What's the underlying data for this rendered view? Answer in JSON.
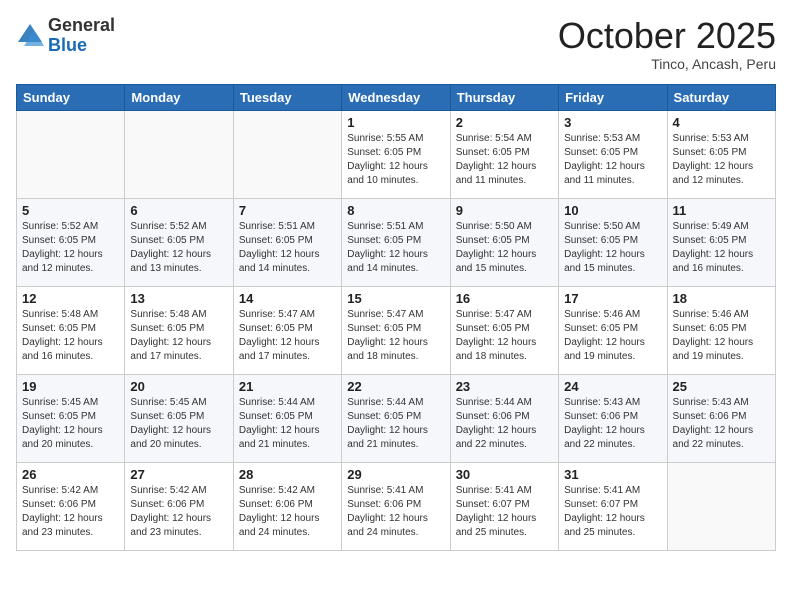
{
  "header": {
    "logo_general": "General",
    "logo_blue": "Blue",
    "month_title": "October 2025",
    "location": "Tinco, Ancash, Peru"
  },
  "weekdays": [
    "Sunday",
    "Monday",
    "Tuesday",
    "Wednesday",
    "Thursday",
    "Friday",
    "Saturday"
  ],
  "weeks": [
    [
      {
        "day": "",
        "info": ""
      },
      {
        "day": "",
        "info": ""
      },
      {
        "day": "",
        "info": ""
      },
      {
        "day": "1",
        "info": "Sunrise: 5:55 AM\nSunset: 6:05 PM\nDaylight: 12 hours\nand 10 minutes."
      },
      {
        "day": "2",
        "info": "Sunrise: 5:54 AM\nSunset: 6:05 PM\nDaylight: 12 hours\nand 11 minutes."
      },
      {
        "day": "3",
        "info": "Sunrise: 5:53 AM\nSunset: 6:05 PM\nDaylight: 12 hours\nand 11 minutes."
      },
      {
        "day": "4",
        "info": "Sunrise: 5:53 AM\nSunset: 6:05 PM\nDaylight: 12 hours\nand 12 minutes."
      }
    ],
    [
      {
        "day": "5",
        "info": "Sunrise: 5:52 AM\nSunset: 6:05 PM\nDaylight: 12 hours\nand 12 minutes."
      },
      {
        "day": "6",
        "info": "Sunrise: 5:52 AM\nSunset: 6:05 PM\nDaylight: 12 hours\nand 13 minutes."
      },
      {
        "day": "7",
        "info": "Sunrise: 5:51 AM\nSunset: 6:05 PM\nDaylight: 12 hours\nand 14 minutes."
      },
      {
        "day": "8",
        "info": "Sunrise: 5:51 AM\nSunset: 6:05 PM\nDaylight: 12 hours\nand 14 minutes."
      },
      {
        "day": "9",
        "info": "Sunrise: 5:50 AM\nSunset: 6:05 PM\nDaylight: 12 hours\nand 15 minutes."
      },
      {
        "day": "10",
        "info": "Sunrise: 5:50 AM\nSunset: 6:05 PM\nDaylight: 12 hours\nand 15 minutes."
      },
      {
        "day": "11",
        "info": "Sunrise: 5:49 AM\nSunset: 6:05 PM\nDaylight: 12 hours\nand 16 minutes."
      }
    ],
    [
      {
        "day": "12",
        "info": "Sunrise: 5:48 AM\nSunset: 6:05 PM\nDaylight: 12 hours\nand 16 minutes."
      },
      {
        "day": "13",
        "info": "Sunrise: 5:48 AM\nSunset: 6:05 PM\nDaylight: 12 hours\nand 17 minutes."
      },
      {
        "day": "14",
        "info": "Sunrise: 5:47 AM\nSunset: 6:05 PM\nDaylight: 12 hours\nand 17 minutes."
      },
      {
        "day": "15",
        "info": "Sunrise: 5:47 AM\nSunset: 6:05 PM\nDaylight: 12 hours\nand 18 minutes."
      },
      {
        "day": "16",
        "info": "Sunrise: 5:47 AM\nSunset: 6:05 PM\nDaylight: 12 hours\nand 18 minutes."
      },
      {
        "day": "17",
        "info": "Sunrise: 5:46 AM\nSunset: 6:05 PM\nDaylight: 12 hours\nand 19 minutes."
      },
      {
        "day": "18",
        "info": "Sunrise: 5:46 AM\nSunset: 6:05 PM\nDaylight: 12 hours\nand 19 minutes."
      }
    ],
    [
      {
        "day": "19",
        "info": "Sunrise: 5:45 AM\nSunset: 6:05 PM\nDaylight: 12 hours\nand 20 minutes."
      },
      {
        "day": "20",
        "info": "Sunrise: 5:45 AM\nSunset: 6:05 PM\nDaylight: 12 hours\nand 20 minutes."
      },
      {
        "day": "21",
        "info": "Sunrise: 5:44 AM\nSunset: 6:05 PM\nDaylight: 12 hours\nand 21 minutes."
      },
      {
        "day": "22",
        "info": "Sunrise: 5:44 AM\nSunset: 6:05 PM\nDaylight: 12 hours\nand 21 minutes."
      },
      {
        "day": "23",
        "info": "Sunrise: 5:44 AM\nSunset: 6:06 PM\nDaylight: 12 hours\nand 22 minutes."
      },
      {
        "day": "24",
        "info": "Sunrise: 5:43 AM\nSunset: 6:06 PM\nDaylight: 12 hours\nand 22 minutes."
      },
      {
        "day": "25",
        "info": "Sunrise: 5:43 AM\nSunset: 6:06 PM\nDaylight: 12 hours\nand 22 minutes."
      }
    ],
    [
      {
        "day": "26",
        "info": "Sunrise: 5:42 AM\nSunset: 6:06 PM\nDaylight: 12 hours\nand 23 minutes."
      },
      {
        "day": "27",
        "info": "Sunrise: 5:42 AM\nSunset: 6:06 PM\nDaylight: 12 hours\nand 23 minutes."
      },
      {
        "day": "28",
        "info": "Sunrise: 5:42 AM\nSunset: 6:06 PM\nDaylight: 12 hours\nand 24 minutes."
      },
      {
        "day": "29",
        "info": "Sunrise: 5:41 AM\nSunset: 6:06 PM\nDaylight: 12 hours\nand 24 minutes."
      },
      {
        "day": "30",
        "info": "Sunrise: 5:41 AM\nSunset: 6:07 PM\nDaylight: 12 hours\nand 25 minutes."
      },
      {
        "day": "31",
        "info": "Sunrise: 5:41 AM\nSunset: 6:07 PM\nDaylight: 12 hours\nand 25 minutes."
      },
      {
        "day": "",
        "info": ""
      }
    ]
  ]
}
